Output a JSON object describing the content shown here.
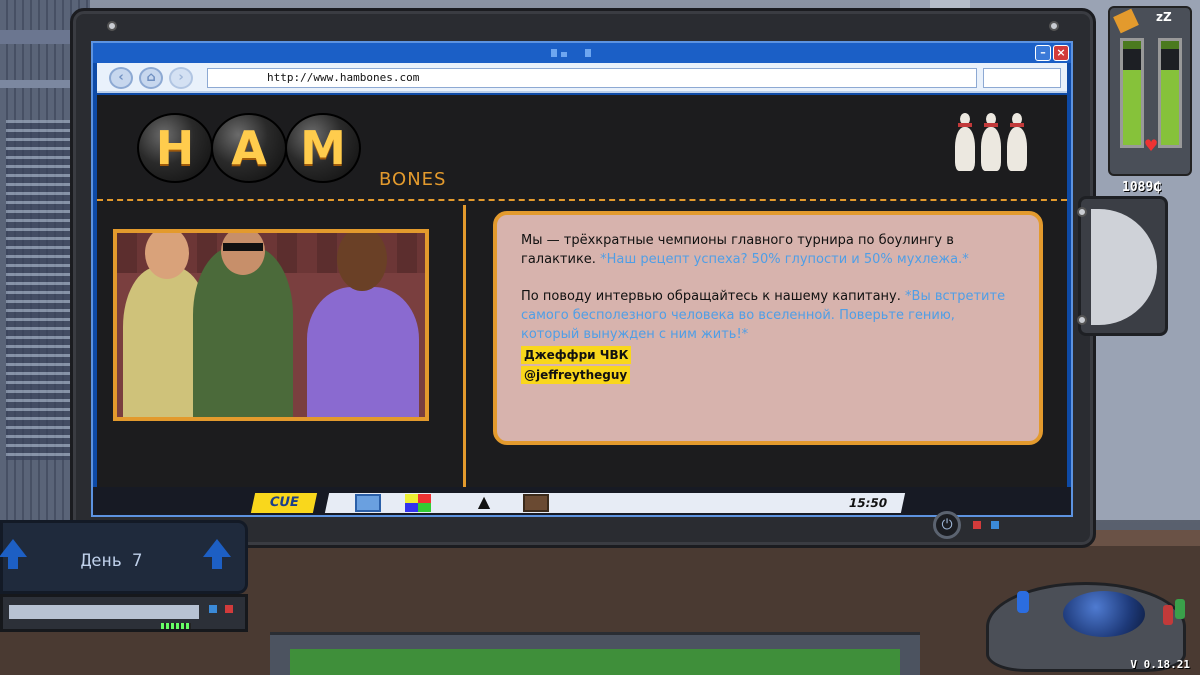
{
  "browser": {
    "url": "http://www.hambones.com",
    "nav_back_icon": "back-arrow-icon",
    "nav_home_icon": "home-icon",
    "nav_forward_icon": "forward-arrow-icon"
  },
  "site": {
    "logo_letters": [
      "H",
      "A",
      "M"
    ],
    "logo_sub": "BONES"
  },
  "bio": {
    "para1_black": "Мы — трёхкратные чемпионы главного турнира по боулингу в галактике.",
    "para1_blue": "*Наш рецепт успеха? 50% глупости и 50% мухлежа.*",
    "para2_black": "По поводу интервью обращайтесь к нашему капитану.",
    "para2_blue": "*Вы встретите самого бесполезного человека во вселенной. Поверьте гению, который вынужден с ним жить!*",
    "name": "Джеффри ЧВК",
    "handle": "@jeffreytheguy"
  },
  "taskbar": {
    "cue_label": "CUE",
    "clock": "15:50",
    "icons": [
      "mail-icon",
      "palette-icon",
      "warning-icon",
      "search-icon"
    ]
  },
  "hud": {
    "credits": "1089₵",
    "gauge_left_level": 0.72,
    "gauge_right_level": 0.72
  },
  "day_panel": {
    "label": "День 7"
  },
  "version": "V 0.18.21",
  "colors": {
    "accent_orange": "#e39a2d",
    "highlight_yellow": "#f9d71c",
    "link_blue": "#4f9ee6",
    "os_blue": "#0e4aa6"
  }
}
